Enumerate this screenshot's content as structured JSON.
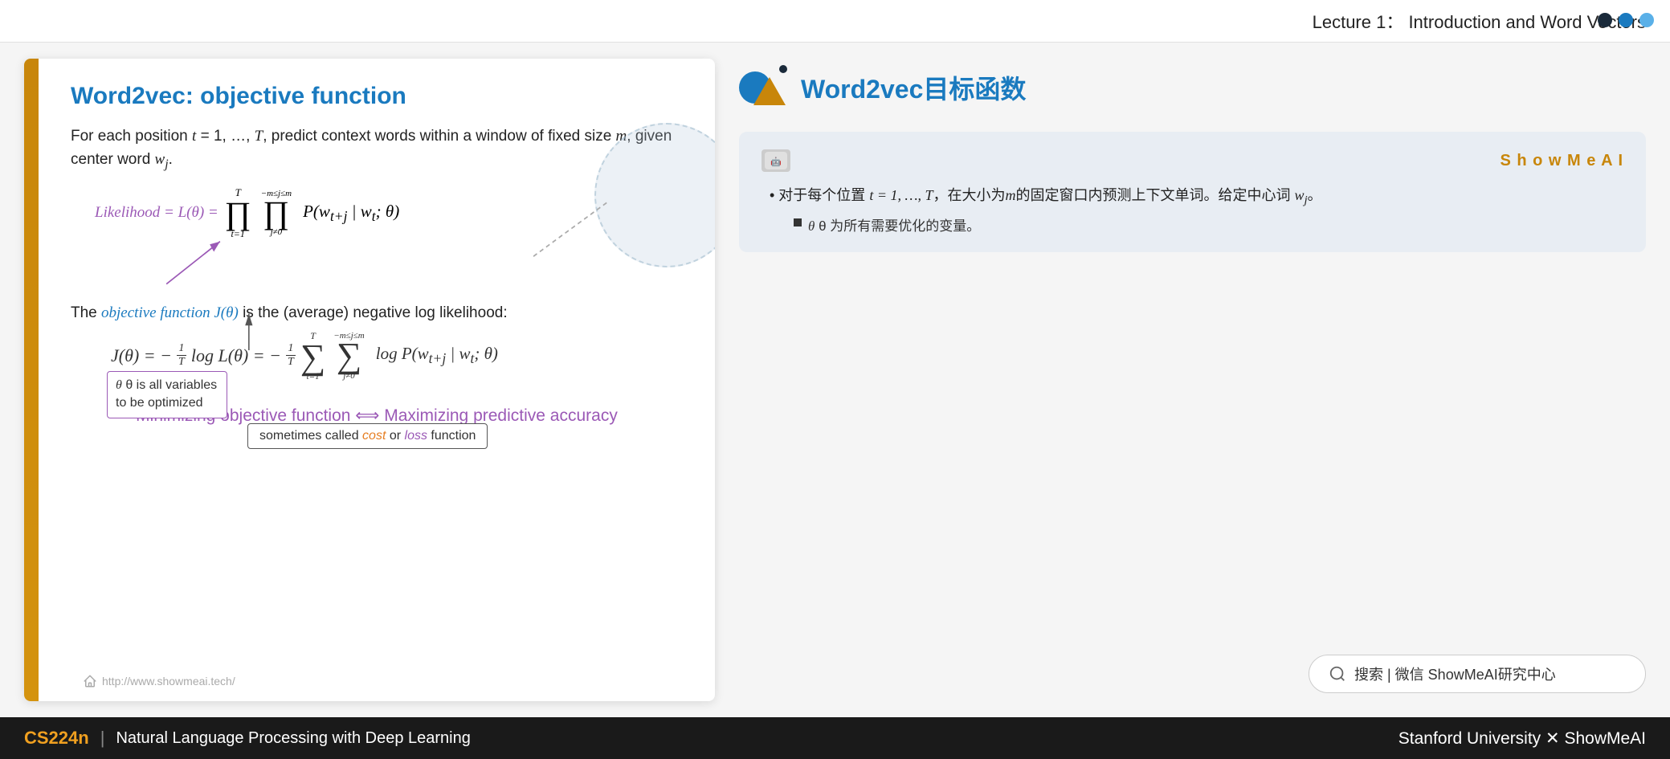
{
  "topbar": {
    "title": "Lecture 1： Introduction and Word Vectors"
  },
  "slide": {
    "title": "Word2vec: objective function",
    "intro": "For each position t = 1, …, T, predict context words within a window of fixed size m, given center word w",
    "intro_subscript": "j",
    "likelihood_label": "Likelihood = L(θ) =",
    "likelihood_formula": "∏ ∏ P(w",
    "annotation_theta": "θ is all variables to be optimized",
    "annotation_sometimes": "sometimes called cost or loss function",
    "cost_word": "cost",
    "loss_word": "loss",
    "objective_text_1": "The",
    "objective_func_label": "objective function J(θ)",
    "objective_text_2": "is the (average) negative log likelihood:",
    "j_formula": "J(θ) = −",
    "minimizing": "Minimizing objective function ⟺ Maximizing predictive accuracy",
    "url": "http://www.showmeai.tech/"
  },
  "right_panel": {
    "title": "Word2vec目标函数",
    "card": {
      "showmeai_label": "S h o w M e A I",
      "bullet1": "对于每个位置 t = 1, …, T，在大小为m的固定窗口内预测上下文单词。给定中心词 w",
      "bullet1_subscript": "j",
      "bullet1_end": "。",
      "sub_bullet": "θ 为所有需要优化的变量。"
    },
    "search": "搜索 | 微信 ShowMeAI研究中心"
  },
  "bottombar": {
    "cs_label": "CS224n",
    "separator": "|",
    "course": "Natural Language Processing with Deep Learning",
    "right": "Stanford University  ✕  ShowMeAI"
  },
  "dots": [
    {
      "color": "#1a2a3a"
    },
    {
      "color": "#1a7abf"
    },
    {
      "color": "#5ab0e8"
    }
  ]
}
